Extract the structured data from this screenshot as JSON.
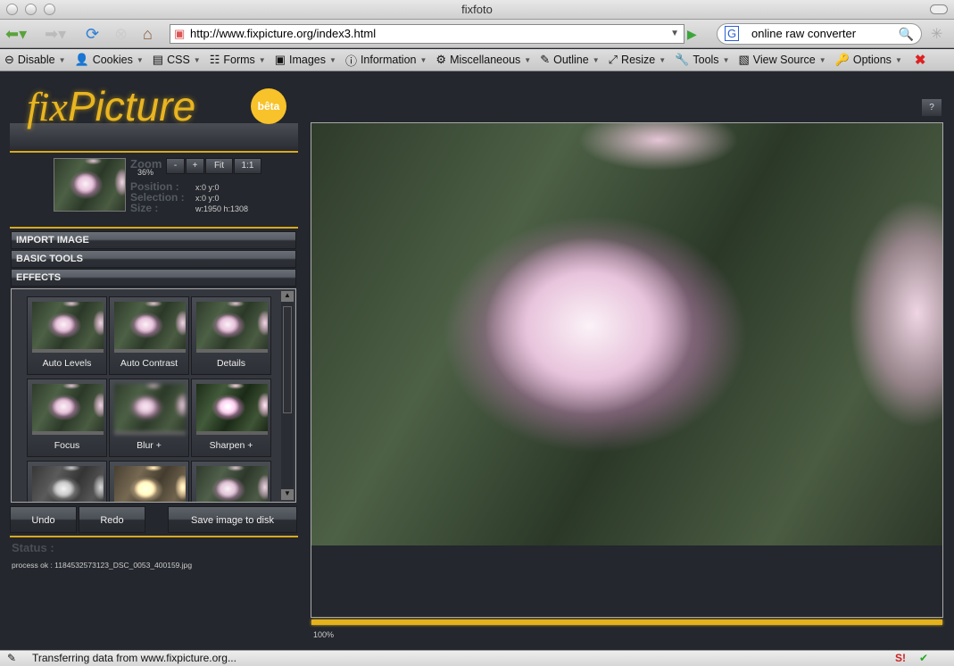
{
  "window": {
    "title": "fixfoto"
  },
  "navbar": {
    "url": "http://www.fixpicture.org/index3.html",
    "search_engine_icon": "G",
    "search_value": "online raw converter"
  },
  "webdev_toolbar": [
    {
      "label": "Disable",
      "icon": "⊖"
    },
    {
      "label": "Cookies",
      "icon": "👤"
    },
    {
      "label": "CSS",
      "icon": "▤"
    },
    {
      "label": "Forms",
      "icon": "☷"
    },
    {
      "label": "Images",
      "icon": "▣"
    },
    {
      "label": "Information",
      "icon": "ⓘ"
    },
    {
      "label": "Miscellaneous",
      "icon": "⚙"
    },
    {
      "label": "Outline",
      "icon": "✎"
    },
    {
      "label": "Resize",
      "icon": "⤢"
    },
    {
      "label": "Tools",
      "icon": "🔧"
    },
    {
      "label": "View Source",
      "icon": "▧"
    },
    {
      "label": "Options",
      "icon": "🔑"
    }
  ],
  "app": {
    "logo_fix": "fix",
    "logo_picture": "Picture",
    "beta": "bêta",
    "help": "?",
    "zoom_label": "Zoom :",
    "zoom_value": "36%",
    "zoom_buttons": [
      "-",
      "+",
      "Fit",
      "1:1"
    ],
    "position_label": "Position :",
    "position_value": "x:0 y:0",
    "selection_label": "Selection :",
    "selection_value": "x:0 y:0",
    "size_label": "Size :",
    "size_value": "w:1950 h:1308",
    "sections": [
      "IMPORT IMAGE",
      "BASIC TOOLS",
      "EFFECTS"
    ],
    "effects": [
      "Auto Levels",
      "Auto Contrast",
      "Details",
      "Focus",
      "Blur +",
      "Sharpen +",
      "",
      "",
      ""
    ],
    "undo": "Undo",
    "redo": "Redo",
    "save": "Save image to disk",
    "status_label": "Status :",
    "status_text": "process ok : 1184532573123_DSC_0053_400159.jpg",
    "progress_percent": 100,
    "progress_label": "100%"
  },
  "statusbar": {
    "text": "Transferring data from www.fixpicture.org..."
  },
  "colors": {
    "accent": "#e3b21d",
    "background": "#24272d"
  }
}
